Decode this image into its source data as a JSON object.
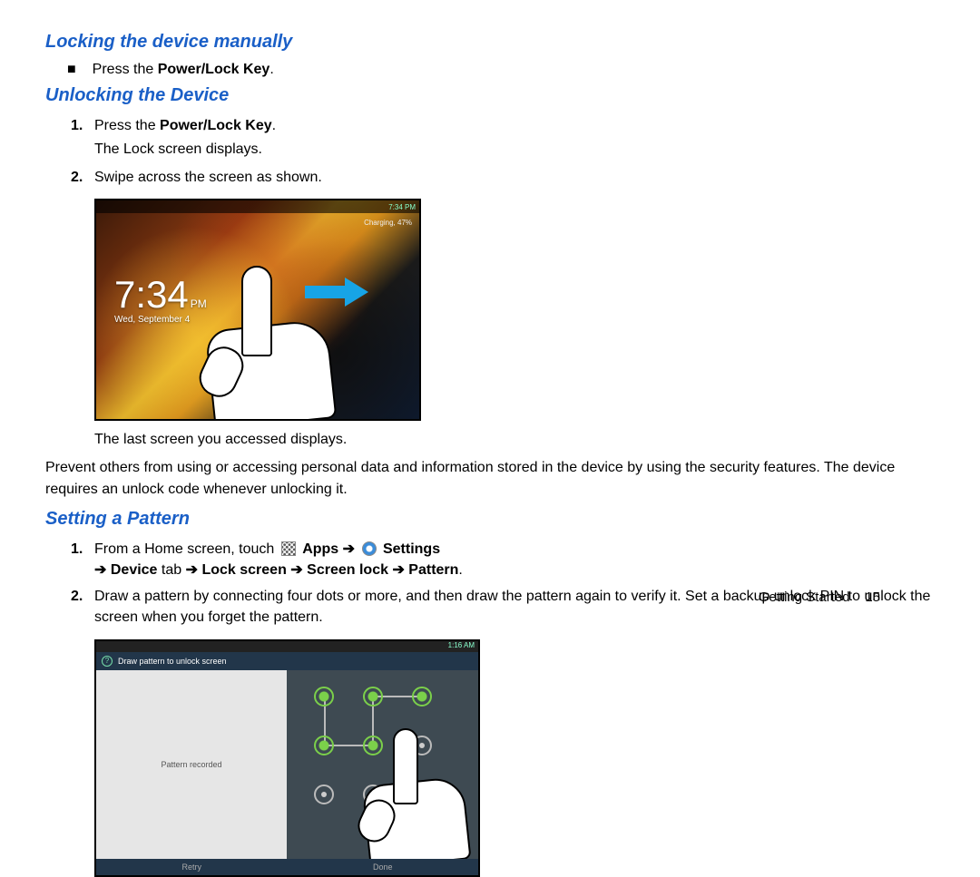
{
  "left": {
    "h1": "Locking the device manually",
    "bullet": {
      "pre": "Press the ",
      "bold": "Power/Lock Key",
      "post": "."
    },
    "h2": "Unlocking the Device",
    "step1": {
      "pre": "Press the ",
      "bold": "Power/Lock Key",
      "post": "."
    },
    "step1b": "The Lock screen displays.",
    "step2": "Swipe across the screen as shown.",
    "after_img": "The last screen you accessed displays.",
    "screenshot": {
      "status_time": "7:34 PM",
      "charging": "Charging, 47%",
      "time": "7:34",
      "pm": "PM",
      "date": "Wed, September 4"
    }
  },
  "right": {
    "intro": "Prevent others from using or accessing personal data and information stored in the device by using the security features. The device requires an unlock code whenever unlocking it.",
    "h3": "Setting a Pattern",
    "step1": {
      "pre": "From a Home screen, touch ",
      "apps": "Apps",
      "arrow": "➔",
      "settings": "Settings",
      "line2a": "Device",
      "line2b": " tab ",
      "line2c": "Lock screen",
      "line2d": "Screen lock",
      "line2e": "Pattern"
    },
    "step2": "Draw a pattern by connecting four dots or more, and then draw the pattern again to verify it. Set a backup unlock PIN to unlock the screen when you forget the pattern.",
    "screenshot": {
      "status": "1:16 AM",
      "title": "Draw pattern to unlock screen",
      "left_label": "Pattern recorded",
      "footer_left": "Retry",
      "footer_right": "Done"
    }
  },
  "footer": {
    "section": "Getting Started",
    "page": "15"
  },
  "numbers": {
    "one": "1.",
    "two": "2."
  },
  "square": "■"
}
